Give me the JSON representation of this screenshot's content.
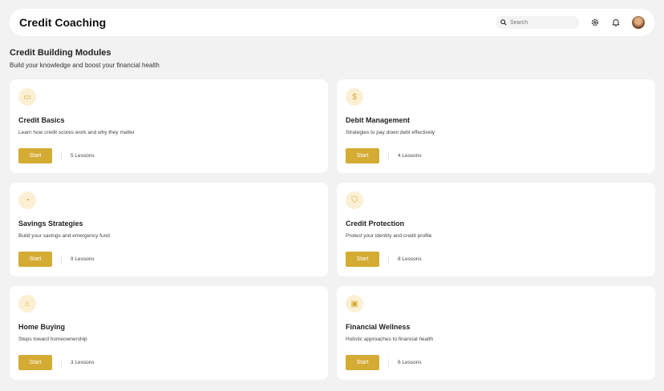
{
  "header": {
    "title": "Credit Coaching",
    "search_placeholder": "Search"
  },
  "section": {
    "title": "Credit Building Modules",
    "subtitle": "Build your knowledge and boost your financial health"
  },
  "start_label": "Start",
  "modules": [
    {
      "icon": "credit-card-icon",
      "glyph": "▭",
      "title": "Credit Basics",
      "desc": "Learn how credit scores work and why they matter",
      "lessons": "5 Lessons"
    },
    {
      "icon": "dollar-icon",
      "glyph": "$",
      "title": "Debit Management",
      "desc": "Strategies to pay down debt effectively",
      "lessons": "4 Lessons"
    },
    {
      "icon": "piggy-bank-icon",
      "glyph": "◔",
      "title": "Savings Strategies",
      "desc": "Build your savings and emergency fund",
      "lessons": "9 Lessons"
    },
    {
      "icon": "shield-icon",
      "glyph": "⛉",
      "title": "Credit Protection",
      "desc": "Protect your identity and credit profile",
      "lessons": "8 Lessons"
    },
    {
      "icon": "home-icon",
      "glyph": "⌂",
      "title": "Home Buying",
      "desc": "Steps toward homeownership",
      "lessons": "3 Lessons"
    },
    {
      "icon": "wallet-icon",
      "glyph": "▣",
      "title": "Financial Wellness",
      "desc": "Holistic approaches to financial health",
      "lessons": "6 Lessons"
    }
  ]
}
